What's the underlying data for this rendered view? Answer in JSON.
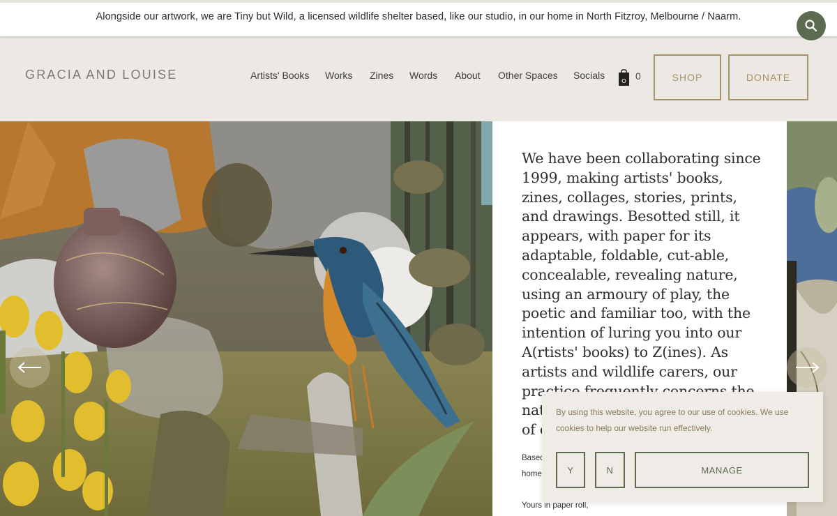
{
  "announcement": {
    "text": "Alongside our artwork, we are Tiny but Wild, a licensed wildlife shelter based, like our studio, in our home in North Fitzroy, Melbourne / Naarm."
  },
  "header": {
    "logo": "GRACIA AND LOUISE",
    "nav": [
      "Artists' Books",
      "Works",
      "Zines",
      "Words",
      "About",
      "Other Spaces",
      "Socials"
    ],
    "cart_count": "0",
    "shop_label": "SHOP",
    "donate_label": "DONATE"
  },
  "hero": {
    "intro": "We have been collaborating since 1999, making artists' books, zines, collages, stories, prints, and drawings. Besotted still, it appears, with paper for its adaptable, foldable, cut-able, concealable, revealing nature, using an armoury of play, the poetic and familiar too, with the intention of luring you into our A(rtists' books) to Z(ines). As artists and wildlife carers, our practice frequently concerns the nat",
    "intro_tail": "of c",
    "small_1": "Based",
    "small_2": "home",
    "signoff": "Yours in paper roll,"
  },
  "cookie": {
    "text": "By using this website, you agree to our use of cookies. We use cookies to help our website run effectively.",
    "yes_label": "Y",
    "no_label": "N",
    "manage_label": "MANAGE"
  },
  "colors": {
    "accent_gold": "#a89366",
    "accent_green": "#5c6a4f",
    "header_bg": "#ece9e4"
  },
  "icons": [
    "search-icon",
    "shopping-bag-icon",
    "arrow-left-icon",
    "arrow-right-icon"
  ]
}
